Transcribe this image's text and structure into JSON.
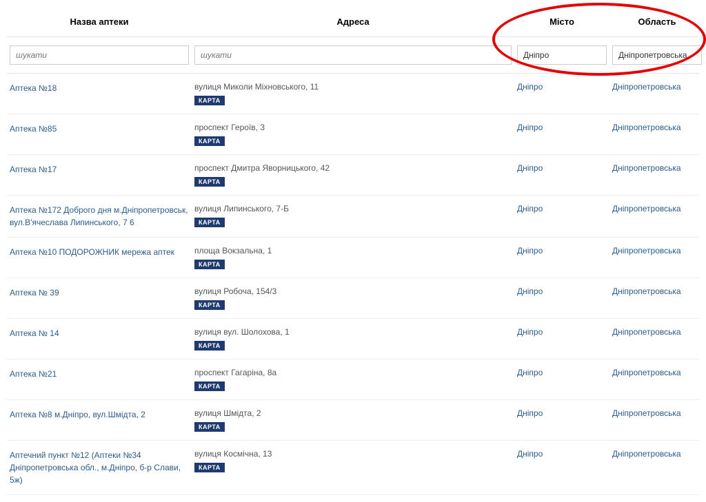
{
  "headers": {
    "name": "Назва аптеки",
    "address": "Адреса",
    "city": "Місто",
    "region": "Область"
  },
  "filters": {
    "name": {
      "placeholder": "шукати",
      "value": ""
    },
    "address": {
      "placeholder": "шукати",
      "value": ""
    },
    "city": {
      "value": "Дніпро"
    },
    "region": {
      "value": "Дніпропетровська"
    }
  },
  "map_badge_label": "КАРТА",
  "rows": [
    {
      "name": "Аптека №18",
      "address": "вулиця Миколи Міхновського, 11",
      "city": "Дніпро",
      "region": "Дніпропетровська"
    },
    {
      "name": "Аптека №85",
      "address": "проспект Героїв, 3",
      "city": "Дніпро",
      "region": "Дніпропетровська"
    },
    {
      "name": "Аптека №17",
      "address": "проспект Дмитра Яворницького, 42",
      "city": "Дніпро",
      "region": "Дніпропетровська"
    },
    {
      "name": "Аптека №172 Доброго дня м.Дніпропетровськ, вул.В'ячеслава Липинського, 7 6",
      "address": "вулиця Липинського, 7-Б",
      "city": "Дніпро",
      "region": "Дніпропетровська"
    },
    {
      "name": "Аптека №10 ПОДОРОЖНИК мережа аптек",
      "address": "площа Вокзальна, 1",
      "city": "Дніпро",
      "region": "Дніпропетровська"
    },
    {
      "name": "Аптека № 39",
      "address": "вулиця Робоча, 154/3",
      "city": "Дніпро",
      "region": "Дніпропетровська"
    },
    {
      "name": "Аптека № 14",
      "address": "вулиця вул. Шолохова, 1",
      "city": "Дніпро",
      "region": "Дніпропетровська"
    },
    {
      "name": "Аптека №21",
      "address": "проспект Гагаріна, 8а",
      "city": "Дніпро",
      "region": "Дніпропетровська"
    },
    {
      "name": "Аптека №8 м.Дніпро, вул.Шмідта, 2",
      "address": "вулиця Шмідта, 2",
      "city": "Дніпро",
      "region": "Дніпропетровська"
    },
    {
      "name": "Аптечний пункт №12 (Аптеки №34 Дніпропетровська обл., м.Дніпро, б-р Слави, 5ж)",
      "address": "вулиця Космічна, 13",
      "city": "Дніпро",
      "region": "Дніпропетровська"
    }
  ]
}
